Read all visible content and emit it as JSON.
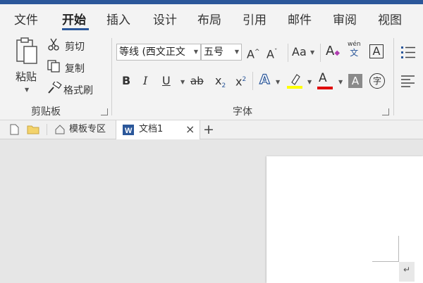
{
  "menu": {
    "items": [
      "文件",
      "开始",
      "插入",
      "设计",
      "布局",
      "引用",
      "邮件",
      "审阅",
      "视图"
    ],
    "active_index": 1
  },
  "clipboard": {
    "paste_label": "粘贴",
    "cut_label": "剪切",
    "copy_label": "复制",
    "format_painter_label": "格式刷",
    "group_label": "剪贴板"
  },
  "font": {
    "font_name": "等线 (西文正文",
    "font_size": "五号",
    "group_label": "字体",
    "grow_label": "A",
    "shrink_label": "A",
    "case_label": "Aa",
    "clear_label": "A",
    "phonetic_top": "wén",
    "phonetic_bottom": "文",
    "border_char": "A",
    "bold": "B",
    "italic": "I",
    "underline": "U",
    "strike": "ab",
    "subscript_base": "x",
    "subscript_mark": "2",
    "superscript_base": "x",
    "superscript_mark": "2",
    "effects": "A",
    "font_color": "A",
    "shading": "A",
    "enclose": "字",
    "highlight_color": "#ffff00",
    "font_color_value": "#e00000"
  },
  "doc_tabs": {
    "template_label": "模板专区",
    "document_label": "文档1",
    "close_glyph": "×",
    "new_glyph": "+"
  },
  "colors": {
    "accent": "#2b579a",
    "word_blue": "#2b579a"
  },
  "document": {
    "paragraph_mark": "↵"
  }
}
